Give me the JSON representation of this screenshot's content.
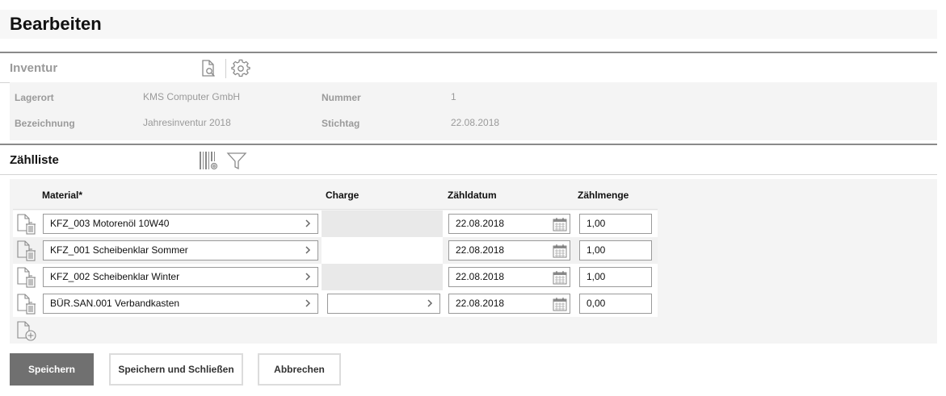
{
  "page": {
    "title": "Bearbeiten"
  },
  "inventur": {
    "title": "Inventur",
    "icons": [
      "document-search-icon",
      "gear-icon"
    ],
    "fields": {
      "lagerort_label": "Lagerort",
      "lagerort_value": "KMS Computer GmbH",
      "bezeichnung_label": "Bezeichnung",
      "bezeichnung_value": "Jahresinventur 2018",
      "nummer_label": "Nummer",
      "nummer_value": "1",
      "stichtag_label": "Stichtag",
      "stichtag_value": "22.08.2018"
    }
  },
  "zaehlliste": {
    "title": "Zählliste",
    "icons": [
      "barcode-settings-icon",
      "filter-icon"
    ],
    "columns": {
      "material": "Material*",
      "charge": "Charge",
      "zaehldatum": "Zähldatum",
      "zaehlmenge": "Zählmenge"
    },
    "rows": [
      {
        "material": "KFZ_003 Motorenöl 10W40",
        "charge_editable": false,
        "charge": "",
        "zaehldatum": "22.08.2018",
        "zaehlmenge": "1,00"
      },
      {
        "material": "KFZ_001 Scheibenklar Sommer",
        "charge_editable": false,
        "charge": "",
        "zaehldatum": "22.08.2018",
        "zaehlmenge": "1,00"
      },
      {
        "material": "KFZ_002 Scheibenklar Winter",
        "charge_editable": false,
        "charge": "",
        "zaehldatum": "22.08.2018",
        "zaehlmenge": "1,00"
      },
      {
        "material": "BÜR.SAN.001 Verbandkasten",
        "charge_editable": true,
        "charge": "",
        "zaehldatum": "22.08.2018",
        "zaehlmenge": "0,00"
      }
    ]
  },
  "buttons": {
    "save": "Speichern",
    "save_close": "Speichern und Schließen",
    "cancel": "Abbrechen"
  },
  "colors": {
    "primary_button": "#707070",
    "section_line": "#8a8a8a",
    "muted_text": "#9a9a9a",
    "panel_bg": "#f4f4f4"
  }
}
